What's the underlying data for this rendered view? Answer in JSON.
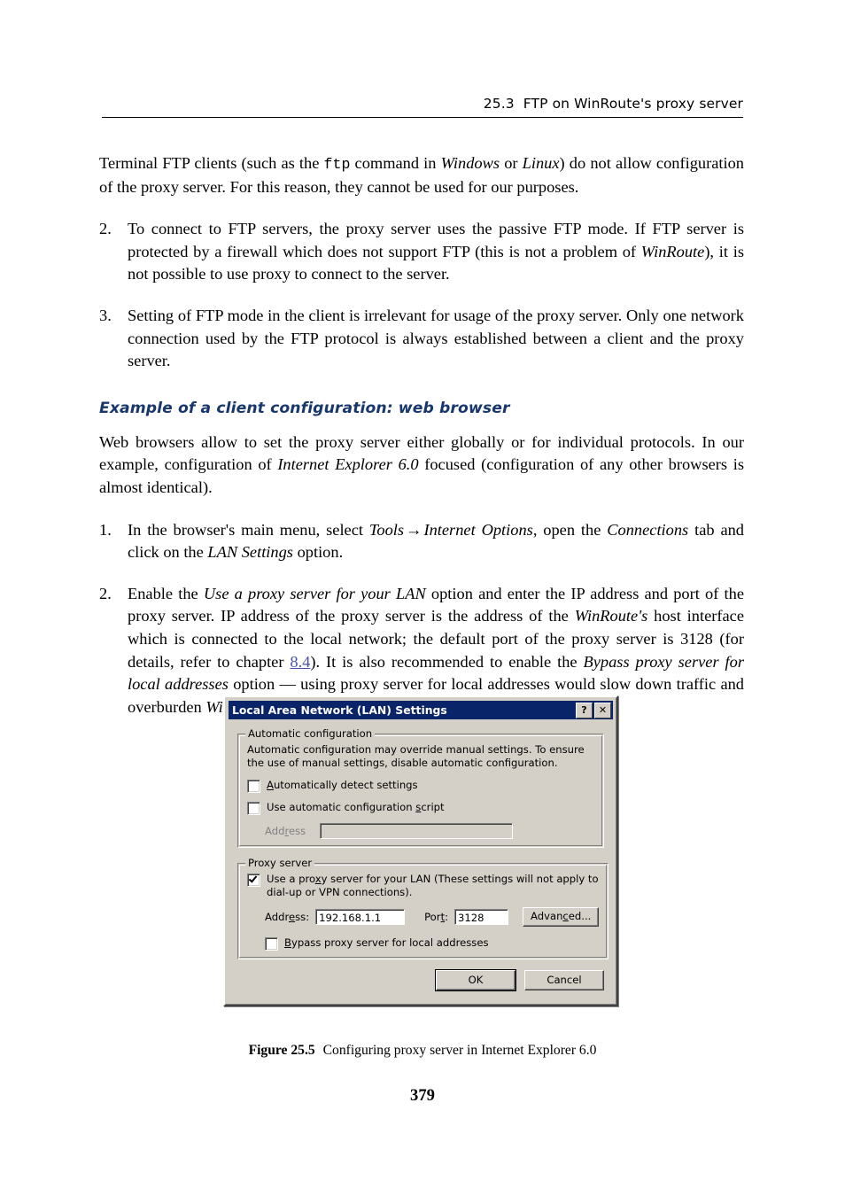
{
  "header": {
    "section_number": "25.3",
    "section_title": "FTP on WinRoute's proxy server"
  },
  "body": {
    "intro_paragraph": {
      "part1": "Terminal FTP clients (such as the ",
      "mono": "ftp",
      "part2": " command in ",
      "italic1": "Windows",
      "part3": " or ",
      "italic2": "Linux",
      "part4": ") do not allow configuration of the proxy server. For this reason, they cannot be used for our purposes."
    },
    "list_top": [
      {
        "number": "2.",
        "part1": "To connect to FTP servers, the proxy server uses the passive FTP mode. If FTP server is protected by a firewall which does not support FTP (this is not a problem of ",
        "italic1": "WinRoute",
        "part2": "), it is not possible to use proxy to connect to the server."
      },
      {
        "number": "3.",
        "part1": "Setting of FTP mode in the client is irrelevant for usage of the proxy server. Only one network connection used by the FTP protocol is always established between a client and the proxy server.",
        "italic1": "",
        "part2": ""
      }
    ],
    "subheading": "Example of a client configuration: web browser",
    "browser_paragraph": {
      "part1": "Web browsers allow to set the proxy server either globally or for individual protocols. In our example, configuration of ",
      "italic1": "Internet Explorer 6.0",
      "part2": " focused (configuration of any other browsers is almost identical)."
    },
    "list_steps": [
      {
        "number": "1.",
        "p1": "In the browser's main menu, select ",
        "i1": "Tools",
        "arrow": "→",
        "i2": "Internet Options",
        "p2": ", open the ",
        "i3": "Connections",
        "p3": " tab and click on the ",
        "i4": "LAN Settings",
        "p4": " option."
      },
      {
        "number": "2.",
        "p1": "Enable the ",
        "i1": "Use a proxy server for your LAN",
        "p2": " option and enter the IP address and port of the proxy server. IP address of the proxy server is the address of the ",
        "i2": "WinRoute's",
        "p3": " host interface which is connected to the local network; the default port of the proxy server is 3128 (for details, refer to chapter ",
        "link": "8.4",
        "p4": "). It is also recommended to enable the ",
        "i3": "Bypass proxy server for local addresses",
        "p5": " option — using proxy server for local addresses would slow down traffic and overburden ",
        "i4": "WinRoute",
        "p6": "."
      }
    ]
  },
  "dialog": {
    "title": "Local Area Network (LAN) Settings",
    "help_button": "?",
    "close_button": "✕",
    "automatic_group": {
      "legend": "Automatic configuration",
      "description": "Automatic configuration may override manual settings.  To ensure the use of manual settings, disable automatic configuration.",
      "checkbox_detect": {
        "label_before": "",
        "accel": "A",
        "label_after": "utomatically detect settings",
        "checked": false
      },
      "checkbox_script": {
        "label_before": "Use automatic configuration ",
        "accel": "s",
        "label_after": "cript",
        "checked": false
      },
      "address_label_before": "Add",
      "address_label_accel": "r",
      "address_label_after": "ess",
      "address_value": "",
      "address_disabled": true
    },
    "proxy_group": {
      "legend": "Proxy server",
      "checkbox_use_proxy": {
        "label_before": "Use a pro",
        "accel": "x",
        "label_after": "y server for your LAN (These settings will not apply to dial-up or VPN connections).",
        "checked": true
      },
      "address_label_before": "Addr",
      "address_label_accel": "e",
      "address_label_after": "ss:",
      "address_value": "192.168.1.1",
      "port_label_before": "Por",
      "port_label_accel": "t",
      "port_label_after": ":",
      "port_value": "3128",
      "advanced_button_before": "Advan",
      "advanced_button_accel": "c",
      "advanced_button_after": "ed...",
      "checkbox_bypass": {
        "label_before": "",
        "accel": "B",
        "label_after": "ypass proxy server for local addresses",
        "checked": false
      }
    },
    "ok_button": "OK",
    "cancel_button": "Cancel"
  },
  "caption": {
    "label": "Figure 25.5",
    "text": "Configuring proxy server in Internet Explorer 6.0"
  },
  "page_number": "379"
}
